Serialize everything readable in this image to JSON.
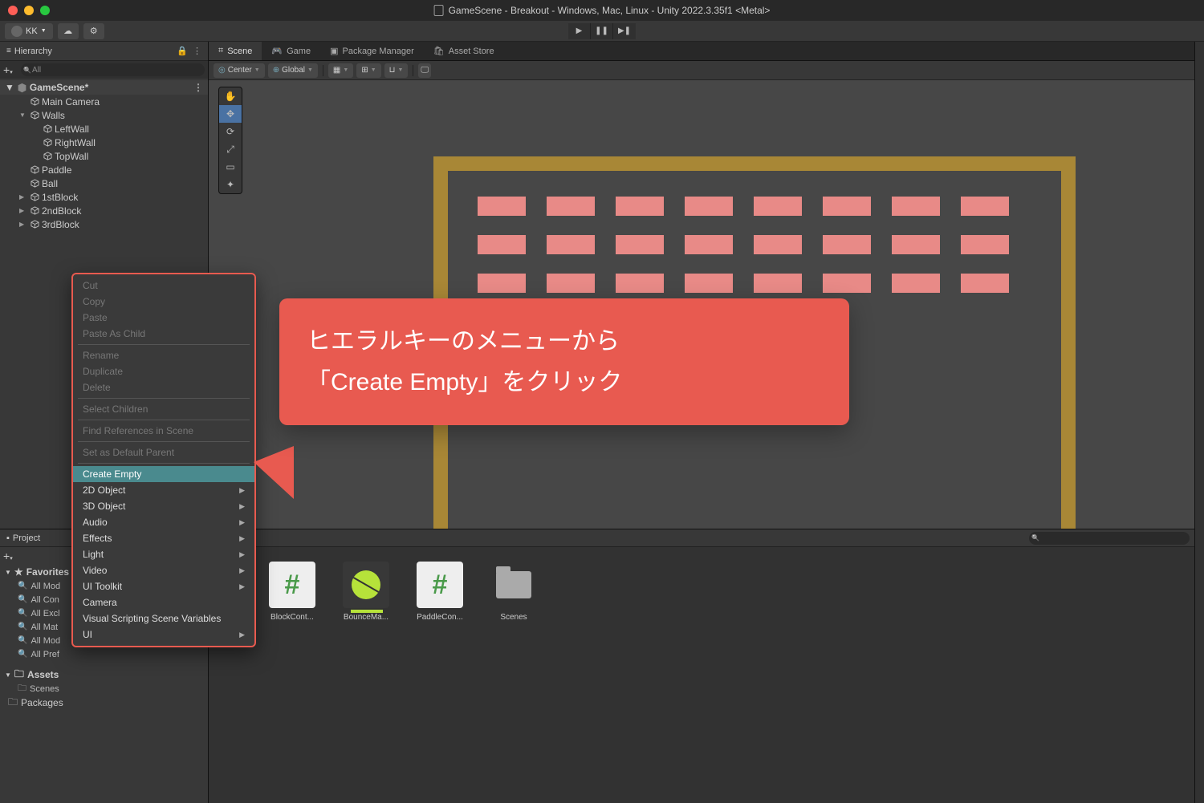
{
  "titlebar": {
    "title": "GameScene - Breakout - Windows, Mac, Linux - Unity 2022.3.35f1 <Metal>"
  },
  "account": {
    "name": "KK"
  },
  "tabs": {
    "scene": "Scene",
    "game": "Game",
    "pkg": "Package Manager",
    "store": "Asset Store"
  },
  "scene_toolbar": {
    "center": "Center",
    "global": "Global"
  },
  "hierarchy": {
    "title": "Hierarchy",
    "search_placeholder": "All",
    "scene": "GameScene*",
    "items": [
      "Main Camera",
      "Walls",
      "LeftWall",
      "RightWall",
      "TopWall",
      "Paddle",
      "Ball",
      "1stBlock",
      "2ndBlock",
      "3rdBlock"
    ]
  },
  "project": {
    "title": "Project",
    "favorites": "Favorites",
    "fav_items": [
      "All Mod",
      "All Con",
      "All Excl",
      "All Mat",
      "All Mod",
      "All Pref"
    ],
    "assets": "Assets",
    "scenes": "Scenes",
    "packages": "Packages"
  },
  "assets_grid": [
    {
      "label": "BlockCont...",
      "kind": "hash"
    },
    {
      "label": "BounceMa...",
      "kind": "ball"
    },
    {
      "label": "PaddleCon...",
      "kind": "hash"
    },
    {
      "label": "Scenes",
      "kind": "folder"
    }
  ],
  "context_menu": {
    "disabled": [
      "Cut",
      "Copy",
      "Paste",
      "Paste As Child",
      "Rename",
      "Duplicate",
      "Delete",
      "Select Children",
      "Find References in Scene",
      "Set as Default Parent"
    ],
    "highlight": "Create Empty",
    "submenu": [
      "2D Object",
      "3D Object",
      "Audio",
      "Effects",
      "Light",
      "Video",
      "UI Toolkit",
      "Camera",
      "Visual Scripting Scene Variables",
      "UI"
    ]
  },
  "callout": {
    "line1": "ヒエラルキーのメニューから",
    "line2": "「Create Empty」をクリック"
  }
}
